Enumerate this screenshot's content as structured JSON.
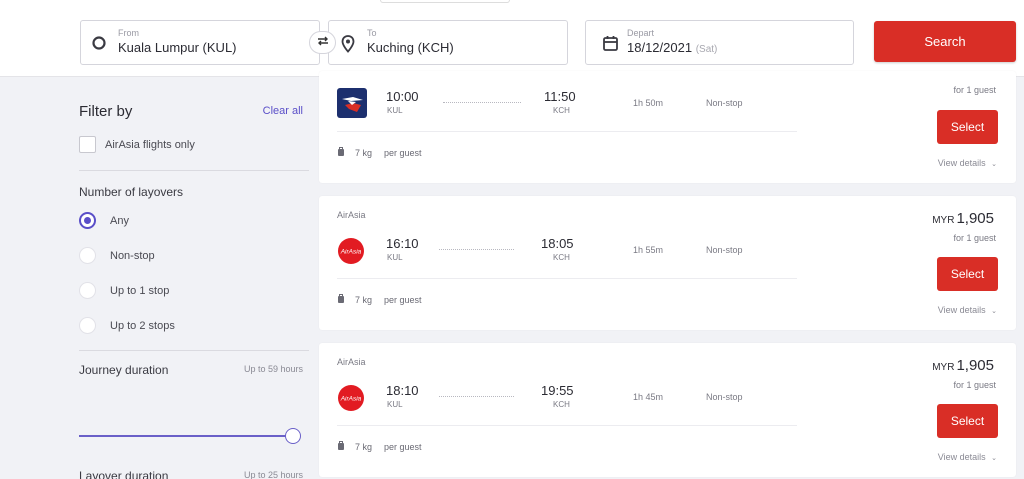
{
  "search": {
    "from_label": "From",
    "from_value": "Kuala Lumpur (KUL)",
    "to_label": "To",
    "to_value": "Kuching (KCH)",
    "depart_label": "Depart",
    "depart_value": "18/12/2021",
    "depart_day": "(Sat)",
    "search_label": "Search"
  },
  "filters": {
    "title": "Filter by",
    "clear_all": "Clear all",
    "airasia_only": "AirAsia flights only",
    "layovers_title": "Number of layovers",
    "layover_options": [
      "Any",
      "Non-stop",
      "Up to 1 stop",
      "Up to 2 stops"
    ],
    "selected_layover": "Any",
    "journey_title": "Journey duration",
    "journey_hint": "Up to 59 hours",
    "journey_slider_value": 1.0,
    "layover_duration_title": "Layover duration",
    "layover_duration_hint": "Up to 25 hours"
  },
  "results": [
    {
      "airline": "",
      "dep_time": "10:00",
      "dep_code": "KUL",
      "arr_time": "11:50",
      "arr_code": "KCH",
      "duration": "1h 50m",
      "stops": "Non-stop",
      "baggage": "7 kg",
      "per_guest": "per guest",
      "currency": "",
      "price": "",
      "guest": "for 1 guest",
      "select": "Select",
      "details": "View details"
    },
    {
      "airline": "AirAsia",
      "dep_time": "16:10",
      "dep_code": "KUL",
      "arr_time": "18:05",
      "arr_code": "KCH",
      "duration": "1h 55m",
      "stops": "Non-stop",
      "baggage": "7 kg",
      "per_guest": "per guest",
      "currency": "MYR",
      "price": "1,905",
      "guest": "for 1 guest",
      "select": "Select",
      "details": "View details"
    },
    {
      "airline": "AirAsia",
      "dep_time": "18:10",
      "dep_code": "KUL",
      "arr_time": "19:55",
      "arr_code": "KCH",
      "duration": "1h 45m",
      "stops": "Non-stop",
      "baggage": "7 kg",
      "per_guest": "per guest",
      "currency": "MYR",
      "price": "1,905",
      "guest": "for 1 guest",
      "select": "Select",
      "details": "View details"
    }
  ],
  "logos": {
    "airasia_text": "AirAsia"
  },
  "colors": {
    "accent_red": "#d92e26",
    "accent_purple": "#5a4fc8",
    "background": "#f1f2f6"
  }
}
